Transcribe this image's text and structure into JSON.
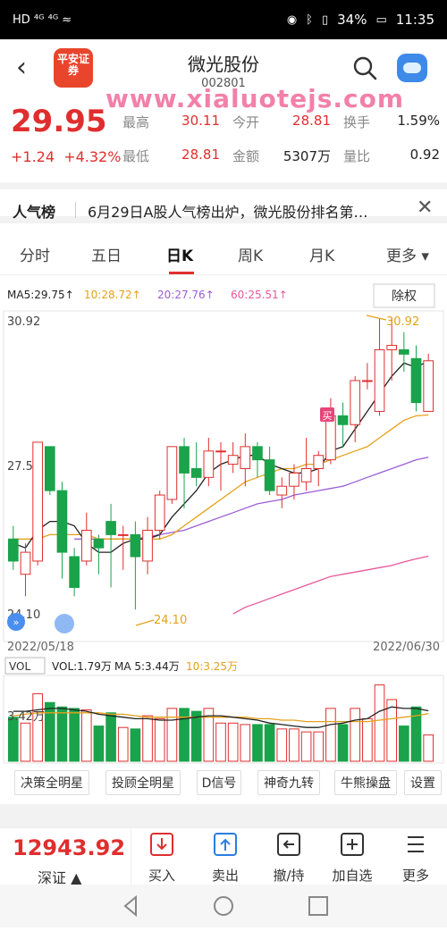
{
  "status_bar": {
    "left": "HD  ⁴ᴳ  ⁴ᴳ  ≈",
    "battery": "34%",
    "time": "11:35"
  },
  "header": {
    "logo_text": "平安证券",
    "title": "微光股份",
    "code": "002801",
    "watermark": "www.xialuotejs.com"
  },
  "quote": {
    "price": "29.95",
    "change": "+1.24",
    "change_pct": "+4.32%",
    "fields": [
      {
        "label": "最高",
        "value": "30.11"
      },
      {
        "label": "今开",
        "value": "28.81"
      },
      {
        "label": "换手",
        "value": "1.59%"
      },
      {
        "label": "最低",
        "value": "28.81"
      },
      {
        "label": "金额",
        "value": "5307万"
      },
      {
        "label": "量比",
        "value": "0.92"
      }
    ]
  },
  "news": {
    "tag": "人气榜",
    "text": "6月29日A股人气榜出炉，微光股份排名第…"
  },
  "tabs": [
    "分时",
    "五日",
    "日K",
    "周K",
    "月K",
    "更多"
  ],
  "active_tab": "日K",
  "chart": {
    "ma_legend": {
      "ma5": "MA5:29.75↑",
      "ma10": "10:28.72↑",
      "ma20": "20:27.76↑",
      "ma60": "60:25.51↑"
    },
    "fq_button": "除权",
    "y_top": "30.92",
    "y_mid": "27.51",
    "y_bot": "24.10",
    "high_tag": "30.92",
    "low_tag": "24.10",
    "buy_tag": "买",
    "date_start": "2022/05/18",
    "date_end": "2022/06/30",
    "vol_button": "VOL",
    "vol_legend": {
      "vol": "VOL:1.79万",
      "ma5": "MA 5:3.44万",
      "ma10": "10:3.25万"
    },
    "vol_y_label": "3.42万",
    "colors": {
      "up": "#e02e2e",
      "down": "#1aa34a",
      "ma5": "#222222",
      "ma10": "#e6a11a",
      "ma20": "#9b5ed6",
      "ma60": "#e8579a"
    }
  },
  "chart_data": {
    "type": "candlestick",
    "y_range": [
      24.1,
      30.92
    ],
    "candles": [
      {
        "o": 25.9,
        "c": 25.4,
        "h": 26.2,
        "l": 25.2
      },
      {
        "o": 25.1,
        "c": 25.6,
        "h": 25.8,
        "l": 24.6
      },
      {
        "o": 25.4,
        "c": 28.1,
        "h": 28.1,
        "l": 25.3
      },
      {
        "o": 28.0,
        "c": 27.0,
        "h": 28.0,
        "l": 26.9
      },
      {
        "o": 27.0,
        "c": 25.6,
        "h": 27.2,
        "l": 25.0
      },
      {
        "o": 25.5,
        "c": 24.8,
        "h": 25.7,
        "l": 24.6
      },
      {
        "o": 25.4,
        "c": 26.1,
        "h": 26.5,
        "l": 25.3
      },
      {
        "o": 25.9,
        "c": 25.7,
        "h": 26.0,
        "l": 25.1
      },
      {
        "o": 26.3,
        "c": 26.0,
        "h": 26.7,
        "l": 24.8
      },
      {
        "o": 26.0,
        "c": 26.0,
        "h": 26.2,
        "l": 25.2
      },
      {
        "o": 26.0,
        "c": 25.5,
        "h": 26.3,
        "l": 24.3
      },
      {
        "o": 25.4,
        "c": 26.1,
        "h": 26.4,
        "l": 25.1
      },
      {
        "o": 26.1,
        "c": 26.9,
        "h": 27.0,
        "l": 25.9
      },
      {
        "o": 26.8,
        "c": 28.0,
        "h": 28.0,
        "l": 26.7
      },
      {
        "o": 28.0,
        "c": 27.4,
        "h": 28.2,
        "l": 26.6
      },
      {
        "o": 27.5,
        "c": 27.3,
        "h": 28.1,
        "l": 27.1
      },
      {
        "o": 27.3,
        "c": 27.9,
        "h": 28.2,
        "l": 27.1
      },
      {
        "o": 27.9,
        "c": 27.9,
        "h": 28.1,
        "l": 27.0
      },
      {
        "o": 27.6,
        "c": 27.8,
        "h": 28.1,
        "l": 27.4
      },
      {
        "o": 27.5,
        "c": 28.0,
        "h": 28.3,
        "l": 27.1
      },
      {
        "o": 28.0,
        "c": 27.7,
        "h": 28.1,
        "l": 27.3
      },
      {
        "o": 27.7,
        "c": 27.0,
        "h": 28.0,
        "l": 26.9
      },
      {
        "o": 26.9,
        "c": 27.1,
        "h": 27.3,
        "l": 26.6
      },
      {
        "o": 27.1,
        "c": 27.4,
        "h": 27.6,
        "l": 26.8
      },
      {
        "o": 27.2,
        "c": 27.5,
        "h": 28.2,
        "l": 27.0
      },
      {
        "o": 27.5,
        "c": 27.8,
        "h": 27.9,
        "l": 27.1
      },
      {
        "o": 27.7,
        "c": 28.7,
        "h": 29.1,
        "l": 27.6
      },
      {
        "o": 28.7,
        "c": 28.5,
        "h": 29.0,
        "l": 28.0
      },
      {
        "o": 28.5,
        "c": 29.5,
        "h": 29.6,
        "l": 28.1
      },
      {
        "o": 29.5,
        "c": 29.5,
        "h": 29.9,
        "l": 29.3
      },
      {
        "o": 28.8,
        "c": 30.2,
        "h": 30.9,
        "l": 28.7
      },
      {
        "o": 30.2,
        "c": 30.3,
        "h": 30.92,
        "l": 29.5
      },
      {
        "o": 30.2,
        "c": 30.1,
        "h": 30.6,
        "l": 29.7
      },
      {
        "o": 30.0,
        "c": 29.0,
        "h": 30.3,
        "l": 28.8
      },
      {
        "o": 28.8,
        "c": 29.95,
        "h": 30.11,
        "l": 28.81
      }
    ],
    "ma5": [
      25.8,
      25.7,
      26.1,
      26.3,
      26.3,
      26.2,
      25.8,
      25.6,
      25.6,
      25.8,
      25.9,
      25.9,
      26.0,
      26.4,
      26.7,
      27.0,
      27.4,
      27.6,
      27.7,
      27.8,
      27.8,
      27.6,
      27.5,
      27.4,
      27.4,
      27.5,
      27.9,
      28.0,
      28.4,
      28.8,
      29.2,
      29.6,
      29.9,
      29.8,
      29.95
    ],
    "ma10": [
      25.9,
      25.9,
      25.9,
      26.0,
      26.0,
      26.0,
      26.0,
      25.9,
      25.9,
      25.9,
      25.9,
      25.9,
      25.9,
      26.0,
      26.2,
      26.4,
      26.6,
      26.8,
      27.0,
      27.2,
      27.3,
      27.4,
      27.5,
      27.5,
      27.6,
      27.6,
      27.7,
      27.8,
      27.9,
      28.0,
      28.2,
      28.4,
      28.6,
      28.7,
      28.72
    ],
    "ma20": [
      null,
      null,
      null,
      null,
      null,
      25.9,
      25.9,
      25.9,
      25.9,
      25.9,
      25.9,
      25.95,
      26.0,
      26.05,
      26.1,
      26.2,
      26.3,
      26.4,
      26.5,
      26.6,
      26.7,
      26.75,
      26.8,
      26.9,
      26.95,
      27.0,
      27.05,
      27.1,
      27.2,
      27.3,
      27.4,
      27.5,
      27.6,
      27.7,
      27.76
    ],
    "ma60": [
      null,
      null,
      null,
      null,
      null,
      null,
      null,
      null,
      null,
      null,
      null,
      null,
      null,
      null,
      null,
      null,
      null,
      null,
      24.2,
      24.35,
      24.45,
      24.55,
      24.65,
      24.75,
      24.85,
      24.95,
      25.05,
      25.1,
      25.15,
      25.2,
      25.25,
      25.3,
      25.38,
      25.45,
      25.51
    ],
    "volume": [
      3.0,
      2.6,
      4.6,
      4.0,
      3.7,
      3.6,
      3.5,
      2.4,
      3.3,
      2.3,
      2.2,
      3.1,
      2.9,
      3.6,
      3.6,
      3.4,
      3.6,
      2.6,
      2.6,
      2.5,
      2.5,
      2.5,
      2.2,
      2.2,
      2.0,
      2.0,
      3.6,
      2.5,
      3.6,
      2.9,
      5.2,
      4.2,
      2.4,
      3.7,
      1.79
    ],
    "vol_ma5": [
      3.4,
      3.4,
      3.5,
      3.6,
      3.6,
      3.5,
      3.4,
      3.2,
      3.1,
      3.0,
      2.9,
      2.9,
      2.8,
      2.8,
      2.9,
      3.0,
      3.1,
      3.1,
      3.0,
      2.9,
      2.8,
      2.6,
      2.5,
      2.4,
      2.3,
      2.3,
      2.5,
      2.6,
      2.8,
      2.9,
      3.4,
      3.7,
      3.6,
      3.6,
      3.44
    ],
    "vol_ma10": [
      3.1,
      3.2,
      3.3,
      3.3,
      3.3,
      3.3,
      3.3,
      3.3,
      3.2,
      3.2,
      3.1,
      3.0,
      3.0,
      3.0,
      3.0,
      3.0,
      3.0,
      3.0,
      3.0,
      3.0,
      2.9,
      2.9,
      2.8,
      2.8,
      2.7,
      2.7,
      2.7,
      2.7,
      2.7,
      2.7,
      2.8,
      2.9,
      3.0,
      3.1,
      3.25
    ],
    "vol_range": [
      0,
      5.6
    ]
  },
  "function_buttons": [
    "决策全明星",
    "投顾全明星",
    "D信号",
    "神奇九转",
    "牛熊操盘",
    "设置"
  ],
  "bottom_bar": {
    "index_value": "12943.92",
    "index_name": "深证 ▲",
    "actions": [
      {
        "label": "买入",
        "icon": "buy-icon",
        "color": "#e02e2e"
      },
      {
        "label": "卖出",
        "icon": "sell-icon",
        "color": "#2a7de1"
      },
      {
        "label": "撤/持",
        "icon": "withdraw-icon",
        "color": "#333"
      },
      {
        "label": "加自选",
        "icon": "add-watchlist-icon",
        "color": "#333"
      },
      {
        "label": "更多",
        "icon": "menu-icon",
        "color": "#333"
      }
    ]
  }
}
